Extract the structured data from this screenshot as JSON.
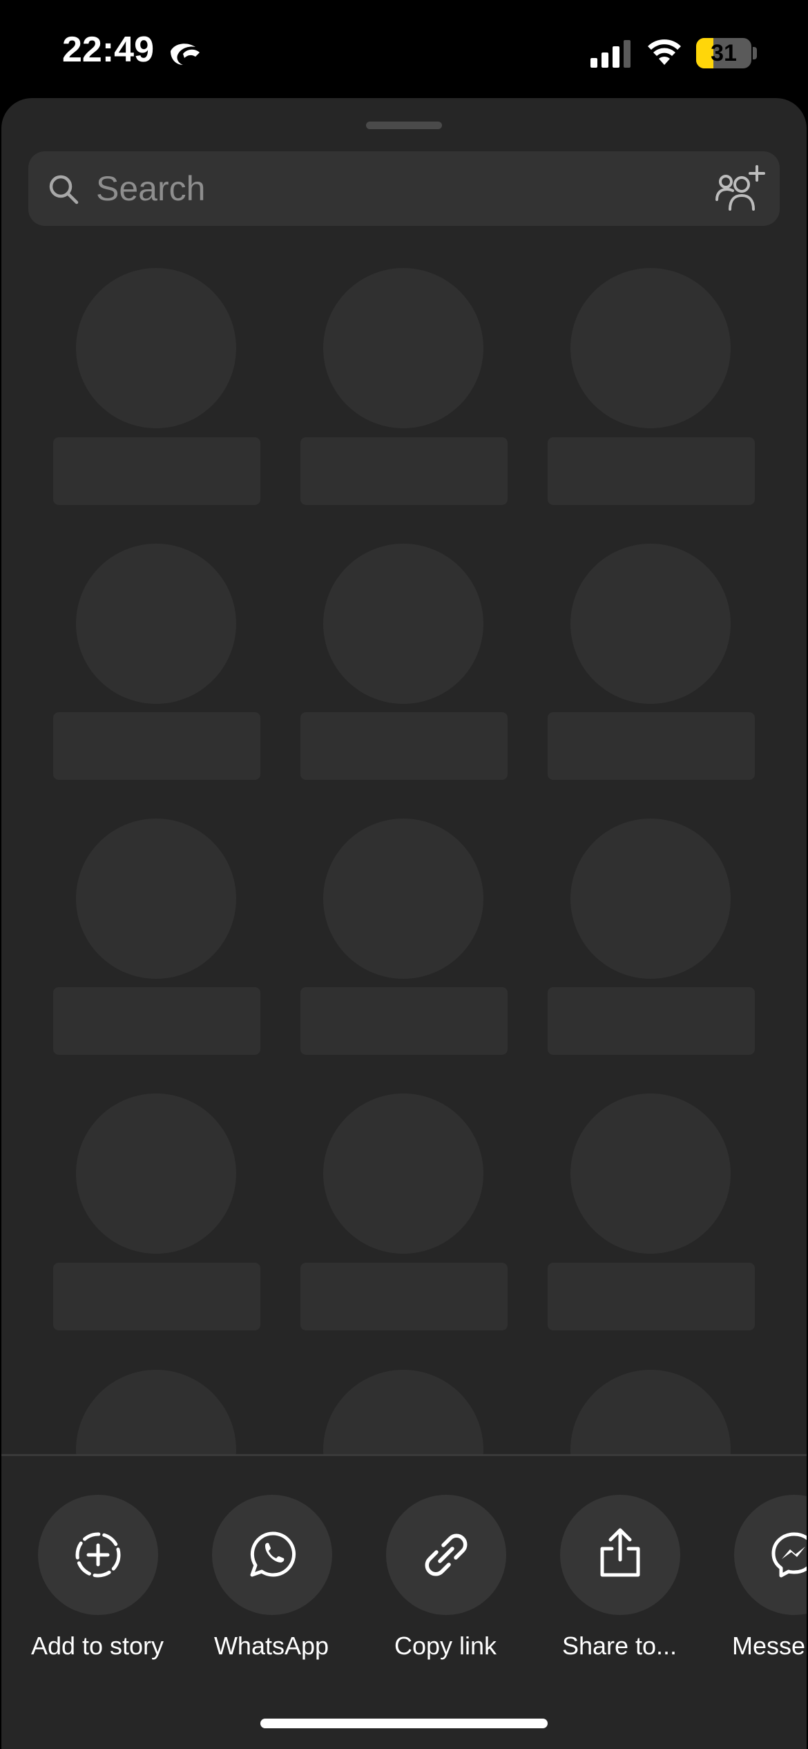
{
  "status_bar": {
    "time": "22:49",
    "battery_level": "31",
    "battery_color": "#ffd60a",
    "icons": [
      "focus-moon-icon",
      "cellular-signal-icon",
      "wifi-icon",
      "battery-icon"
    ]
  },
  "search": {
    "placeholder": "Search",
    "value": "",
    "add_people_icon": "add-people-icon"
  },
  "loading_grid": {
    "columns": 3,
    "rows_visible": 5
  },
  "share_actions": [
    {
      "label": "Add to story",
      "icon": "add-story-icon"
    },
    {
      "label": "WhatsApp",
      "icon": "whatsapp-icon"
    },
    {
      "label": "Copy link",
      "icon": "link-icon"
    },
    {
      "label": "Share to...",
      "icon": "share-icon"
    },
    {
      "label": "Messenger",
      "icon": "messenger-icon"
    }
  ],
  "colors": {
    "sheet_background": "#262626",
    "skeleton": "#303030",
    "action_circle": "#363636"
  }
}
